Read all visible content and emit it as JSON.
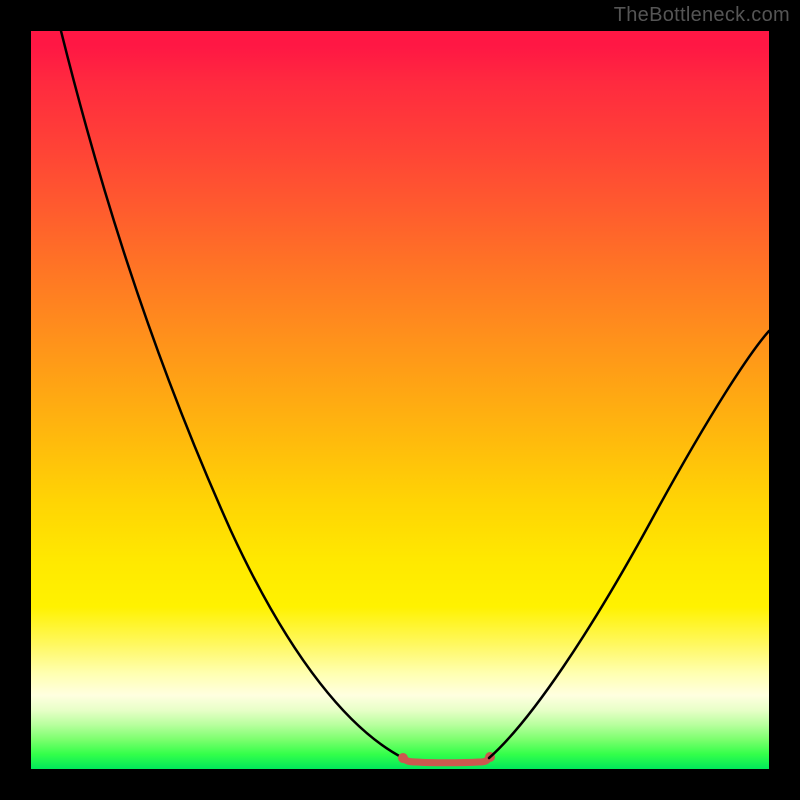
{
  "watermark": "TheBottleneck.com",
  "chart_data": {
    "type": "line",
    "title": "",
    "xlabel": "",
    "ylabel": "",
    "xlim": [
      0,
      100
    ],
    "ylim": [
      0,
      100
    ],
    "grid": false,
    "legend": false,
    "gradient_stops": [
      {
        "pos": 0,
        "color": "#ff1744"
      },
      {
        "pos": 50,
        "color": "#ffbc0c"
      },
      {
        "pos": 80,
        "color": "#fff200"
      },
      {
        "pos": 100,
        "color": "#00e85a"
      }
    ],
    "series": [
      {
        "name": "left-curve",
        "color": "#000000",
        "x": [
          4,
          8,
          12,
          16,
          20,
          24,
          28,
          32,
          36,
          40,
          44,
          48,
          50.5
        ],
        "y": [
          100,
          91,
          82,
          73,
          64,
          55,
          46,
          37,
          28,
          19,
          11,
          4,
          1.5
        ]
      },
      {
        "name": "flat-bottom",
        "color": "#cc594f",
        "x": [
          50.5,
          52,
          54,
          56,
          58,
          60,
          62
        ],
        "y": [
          1.5,
          1.2,
          1.0,
          1.0,
          1.0,
          1.2,
          1.5
        ]
      },
      {
        "name": "right-curve",
        "color": "#000000",
        "x": [
          62,
          66,
          70,
          74,
          78,
          82,
          86,
          90,
          94,
          98,
          100
        ],
        "y": [
          1.5,
          5,
          10,
          16,
          23,
          30,
          37,
          44,
          50,
          56,
          59
        ]
      }
    ],
    "annotations": []
  }
}
